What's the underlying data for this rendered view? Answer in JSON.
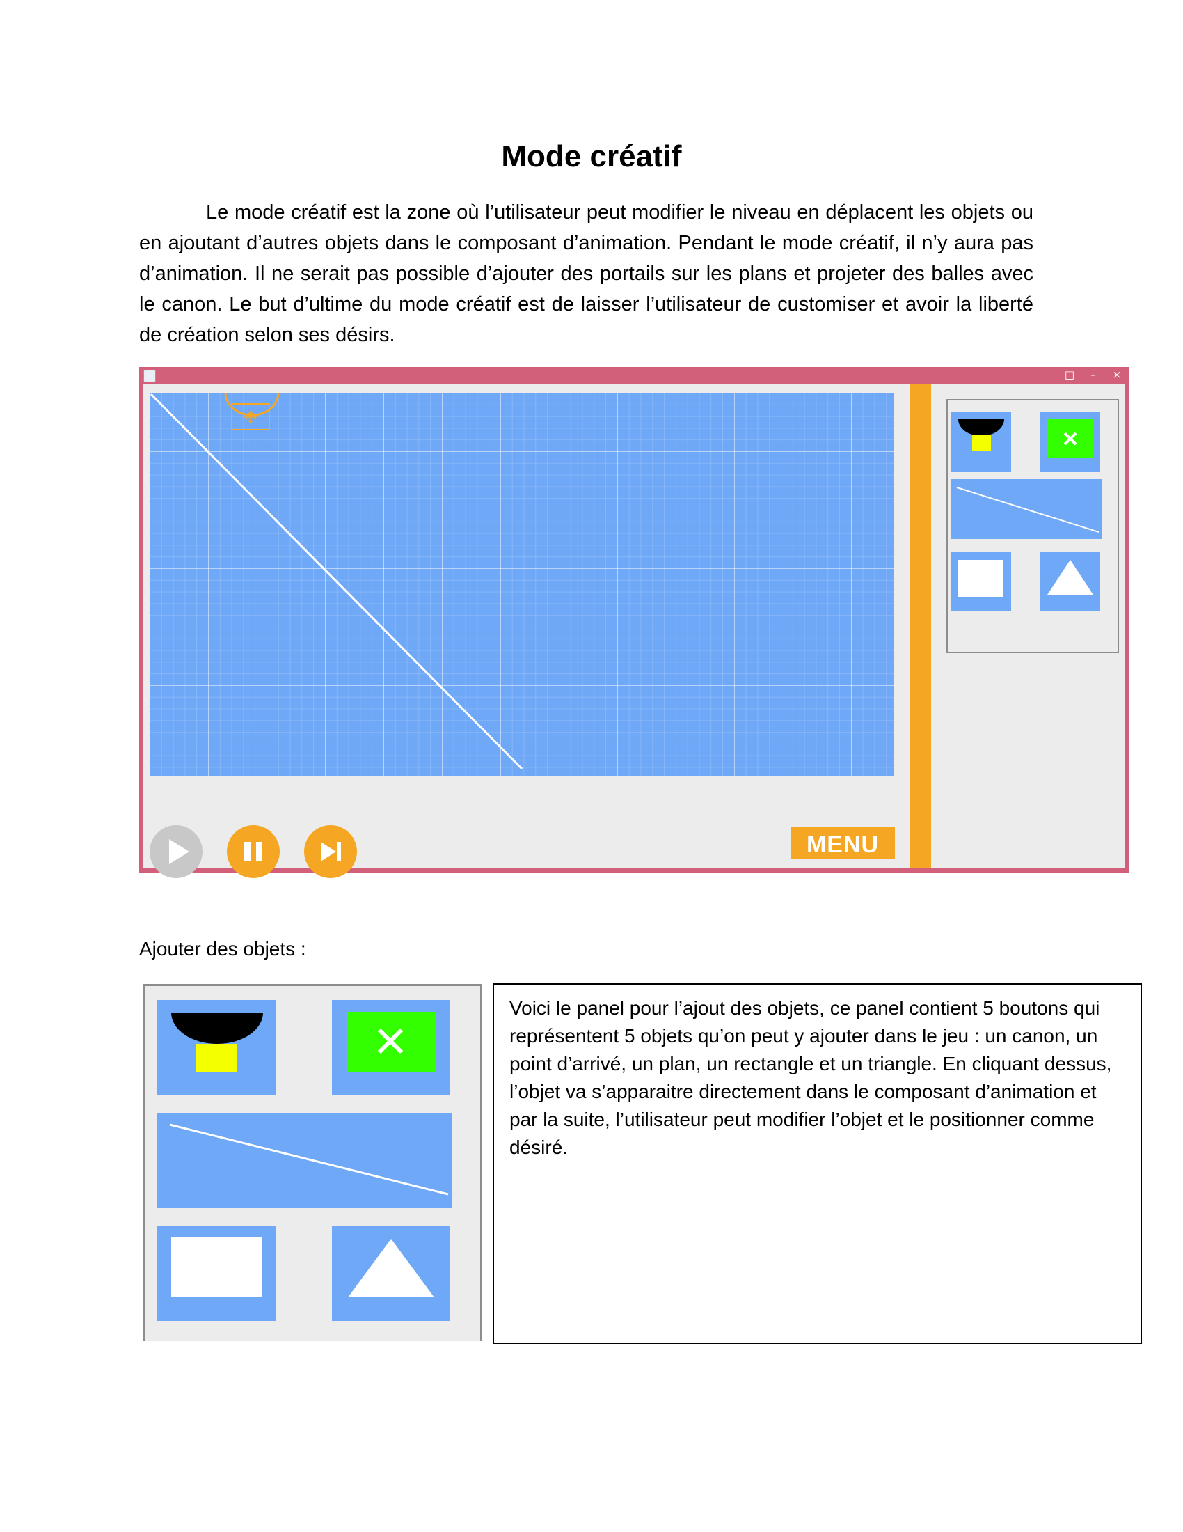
{
  "document": {
    "title": "Mode créatif",
    "intro_paragraph": "Le mode créatif est la zone où l’utilisateur peut modifier le niveau en déplacent les objets ou en ajoutant d’autres objets dans le composant d’animation. Pendant le mode créatif, il n’y aura pas d’animation. Il ne serait pas possible d’ajouter des portails sur les plans et projeter des balles avec le canon. Le but d’ultime du mode créatif est de laisser l’utilisateur de customiser et avoir la liberté de création selon ses désirs.",
    "section_heading": "Ajouter des objets :",
    "panel_description": "Voici le panel pour l’ajout des objets, ce panel contient 5 boutons qui représentent 5 objets qu’on peut y ajouter dans le jeu : un canon, un point d’arrivé, un plan, un rectangle et un triangle. En cliquant dessus, l’objet va s’apparaitre directement dans le composant d’animation et par la suite, l’utilisateur peut modifier l’objet et le positionner comme désiré."
  },
  "app_window": {
    "controls": {
      "minimize": "–",
      "maximize": "□",
      "close": "×"
    },
    "menu_label": "MENU",
    "playback": {
      "play": "play-icon",
      "pause": "pause-icon",
      "step": "step-forward-icon"
    }
  },
  "object_panel": {
    "buttons": [
      "canon-icon",
      "arrival-point-icon",
      "plane-icon",
      "rectangle-icon",
      "triangle-icon"
    ]
  },
  "colors": {
    "window_frame": "#d2607a",
    "canvas": "#6fa8f7",
    "accent_orange": "#f5a623",
    "play_disabled": "#c8c8c8",
    "arrival_green": "#33ff00",
    "canon_yellow": "#f4ff00"
  }
}
